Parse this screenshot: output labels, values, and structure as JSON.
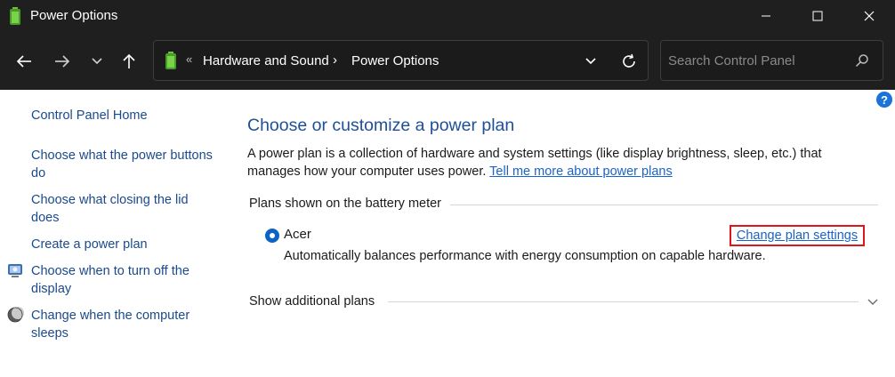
{
  "window": {
    "title": "Power Options",
    "app_icon": "battery-icon",
    "controls": [
      "minimize-icon",
      "maximize-icon",
      "close-icon"
    ]
  },
  "navigation": {
    "buttons": [
      "back-arrow-icon",
      "forward-arrow-icon",
      "recent-locations-icon",
      "up-arrow-icon"
    ],
    "address": {
      "icon": "battery-icon",
      "overflow": "«",
      "breadcrumbs": [
        "Hardware and Sound",
        "Power Options"
      ],
      "separator": "›"
    },
    "search": {
      "placeholder": "Search Control Panel",
      "value": ""
    }
  },
  "help": {
    "label": "?"
  },
  "sidebar": {
    "items": [
      {
        "label": "Control Panel Home",
        "icon": null
      },
      {
        "label": "Choose what the power buttons do",
        "icon": null
      },
      {
        "label": "Choose what closing the lid does",
        "icon": null
      },
      {
        "label": "Create a power plan",
        "icon": null
      },
      {
        "label": "Choose when to turn off the display",
        "icon": "display-icon"
      },
      {
        "label": "Change when the computer sleeps",
        "icon": "moon-icon"
      }
    ]
  },
  "main": {
    "title": "Choose or customize a power plan",
    "description": "A power plan is a collection of hardware and system settings (like display brightness, sleep, etc.) that manages how your computer uses power. ",
    "learn_more_link": "Tell me more about power plans",
    "section_label": "Plans shown on the battery meter",
    "plan": {
      "name": "Acer",
      "selected": true,
      "change_link": "Change plan settings",
      "description": "Automatically balances performance with energy consumption on capable hardware."
    },
    "additional_plans_label": "Show additional plans"
  },
  "colors": {
    "chrome_background": "#1f1f1f",
    "link": "#1a63c9",
    "heading": "#1e4f99",
    "highlight_box": "#e0141b",
    "radio_selected": "#0b63c4"
  }
}
